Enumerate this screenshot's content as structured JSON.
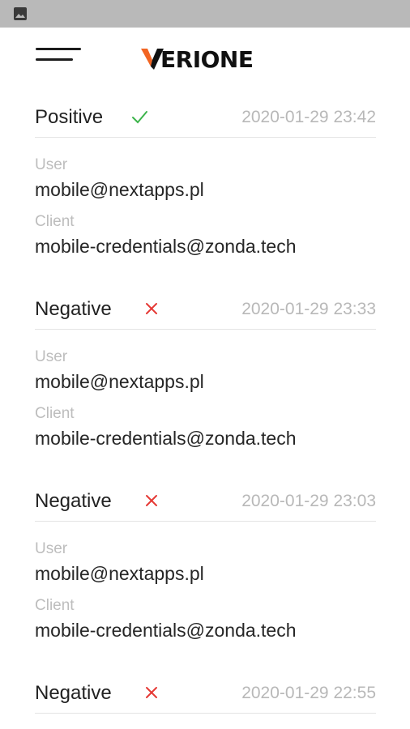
{
  "app": {
    "logo_text": "ERIONE",
    "accent_color": "#f26522"
  },
  "status_bar": {
    "icon": "image-icon"
  },
  "labels": {
    "user": "User",
    "client": "Client"
  },
  "entries": [
    {
      "status": "Positive",
      "result_icon": "check-icon",
      "timestamp": "2020-01-29 23:42",
      "user": "mobile@nextapps.pl",
      "client": "mobile-credentials@zonda.tech"
    },
    {
      "status": "Negative",
      "result_icon": "cross-icon",
      "timestamp": "2020-01-29 23:33",
      "user": "mobile@nextapps.pl",
      "client": "mobile-credentials@zonda.tech"
    },
    {
      "status": "Negative",
      "result_icon": "cross-icon",
      "timestamp": "2020-01-29 23:03",
      "user": "mobile@nextapps.pl",
      "client": "mobile-credentials@zonda.tech"
    },
    {
      "status": "Negative",
      "result_icon": "cross-icon",
      "timestamp": "2020-01-29 22:55"
    }
  ],
  "colors": {
    "positive": "#3cb44b",
    "negative": "#e53935"
  }
}
